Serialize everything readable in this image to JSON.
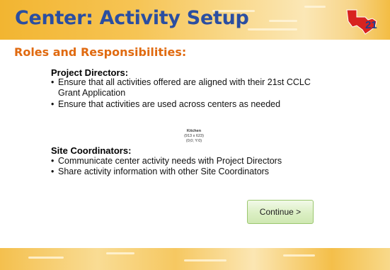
{
  "header": {
    "title": "Center: Activity Setup",
    "logo_text": "21"
  },
  "subtitle": "Roles and Responsibilities:",
  "project_directors": {
    "heading": "Project Directors:",
    "bullets": [
      "Ensure that all activities offered are aligned with their 21st CCLC Grant Application",
      "Ensure that activities are used across centers as needed"
    ]
  },
  "image_placeholder": {
    "line1": "Kitchen",
    "line2": "(913 x 623)",
    "line3": "(0;0; Y:0)"
  },
  "site_coordinators": {
    "heading": "Site Coordinators:",
    "bullets": [
      "Communicate center activity needs with Project Directors",
      "Share activity information with other Site Coordinators"
    ]
  },
  "continue_button": {
    "label": "Continue >"
  },
  "colors": {
    "title": "#2a4ea1",
    "subtitle": "#e06a10",
    "banner": "#f6c454",
    "button": "#dbefc4",
    "logo_red": "#d8231f"
  }
}
